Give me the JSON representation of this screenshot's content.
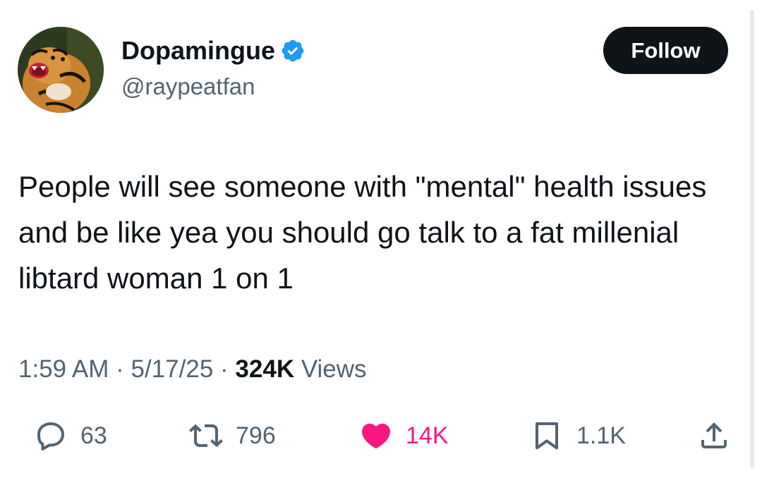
{
  "author": {
    "display_name": "Dopamingue",
    "handle": "@raypeatfan",
    "avatar_icon": "tiger-avatar",
    "verified_icon": "verified-badge-icon",
    "verified_color": "#1d9bf0"
  },
  "follow_button": {
    "label": "Follow"
  },
  "tweet": {
    "text": "People will see someone with \"mental\" health issues and be like yea you should go talk to a fat millenial libtard woman 1 on 1"
  },
  "meta": {
    "time": "1:59 AM",
    "separator": " · ",
    "date": "5/17/25",
    "views_count": "324K",
    "views_label": " Views"
  },
  "actions": {
    "reply": {
      "icon": "reply-icon",
      "count": "63"
    },
    "retweet": {
      "icon": "retweet-icon",
      "count": "796"
    },
    "like": {
      "icon": "heart-icon",
      "count": "14K",
      "color": "#f91880"
    },
    "bookmark": {
      "icon": "bookmark-icon",
      "count": "1.1K"
    },
    "share": {
      "icon": "share-icon"
    }
  }
}
